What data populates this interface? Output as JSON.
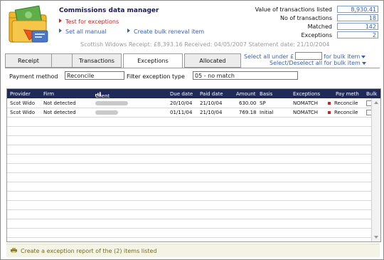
{
  "app": {
    "title": "Commissions data manager",
    "actions": [
      {
        "label": "Test for exceptions"
      },
      {
        "label": "Set all manual"
      },
      {
        "label": "Create bulk reneval item"
      }
    ],
    "info_line": "Scottish Widows Receipt: £8,393.16  Received: 04/05/2007  Statement date: 21/10/2004"
  },
  "stats": [
    {
      "label": "Value of transactions listed",
      "value": "8,930.41"
    },
    {
      "label": "No of transactions",
      "value": "18"
    },
    {
      "label": "Matched",
      "value": "142"
    },
    {
      "label": "Exceptions",
      "value": "2"
    }
  ],
  "tabs": [
    {
      "label": "Receipt"
    },
    {
      "label": "Transactions"
    },
    {
      "label": "Exceptions"
    },
    {
      "label": "Allocated"
    }
  ],
  "bulk": {
    "select_under_prefix": "Select all under £",
    "select_under_suffix": "for bulk item",
    "select_deselect": "Select/Deselect all for bulk item"
  },
  "filters": {
    "payment_method_label": "Payment method",
    "payment_method_value": "Reconcile",
    "exception_type_label": "Filter exception type",
    "exception_type_value": "05 - no match"
  },
  "grid": {
    "headers": [
      "Provider",
      "Firm",
      "Client",
      "Due date",
      "Paid date",
      "Amount",
      "Basis",
      "Exceptions",
      "Pay meth",
      "Bulk"
    ],
    "rows": [
      {
        "provider": "Scot Wido",
        "firm": "Not detected",
        "due": "20/10/04",
        "paid": "21/10/04",
        "amount": "630.00",
        "basis": "SP",
        "exception": "NOMATCH",
        "pay_meth": "Reconcile"
      },
      {
        "provider": "Scot Wido",
        "firm": "Not detected",
        "due": "01/11/04",
        "paid": "21/10/04",
        "amount": "769.18",
        "basis": "Initial",
        "exception": "NOMATCH",
        "pay_meth": "Reconcile"
      }
    ]
  },
  "footer": {
    "label": "Create a exception report of the (2) items listed"
  },
  "colors": {
    "header_bg": "#1f2a5a",
    "link_blue": "#3a62b3",
    "action_red": "#cc2222"
  }
}
